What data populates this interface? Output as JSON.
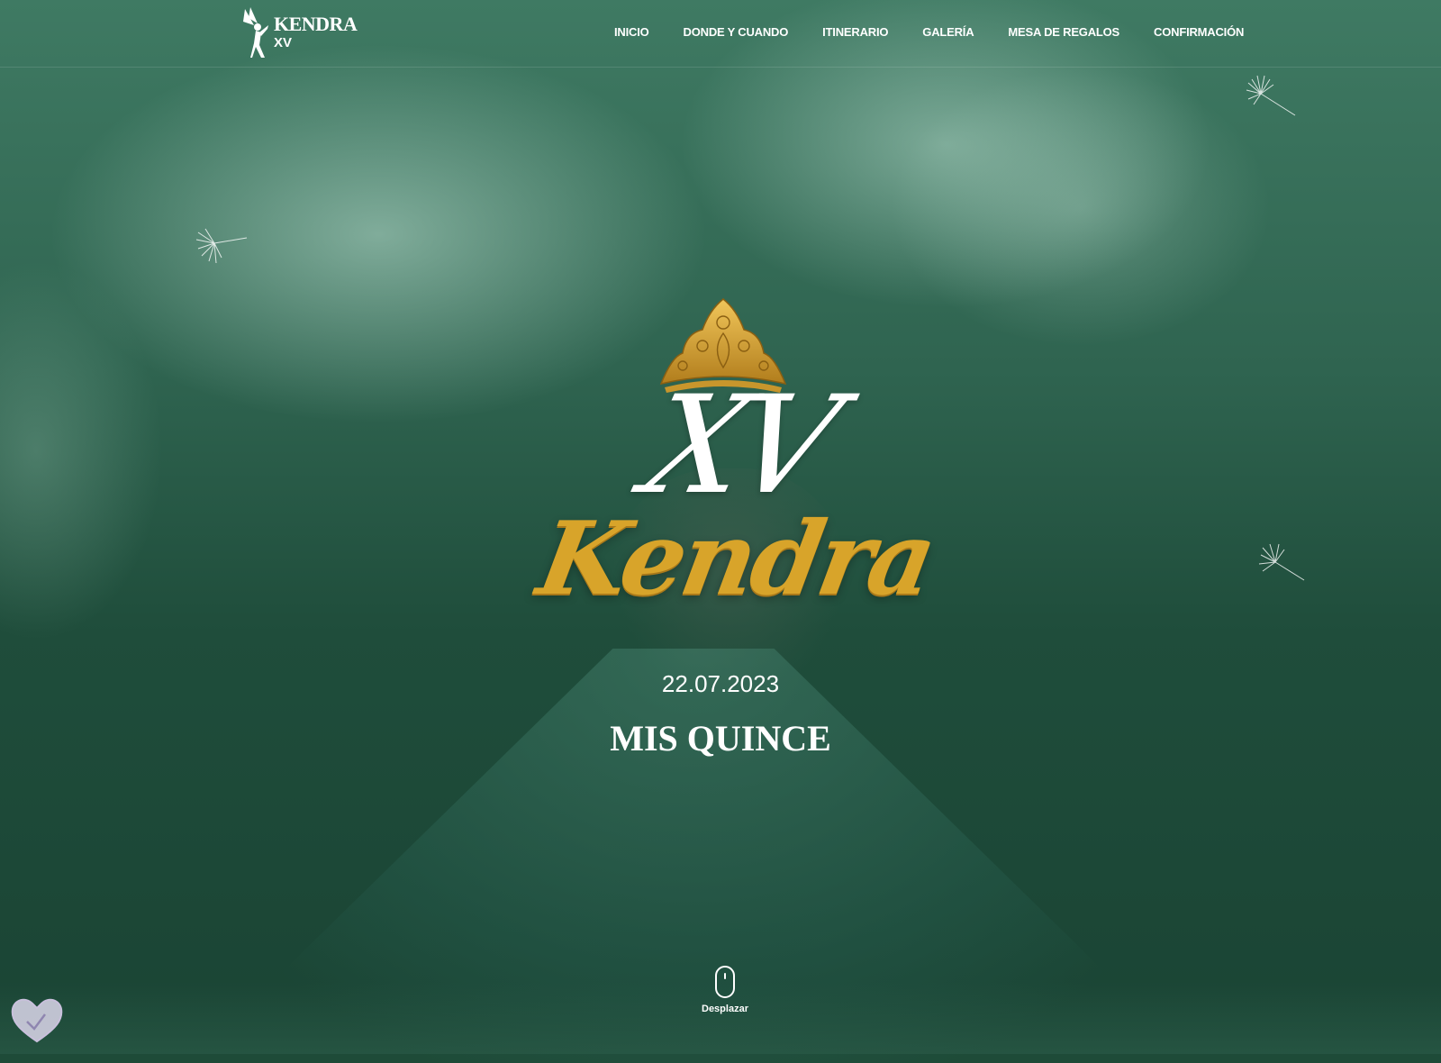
{
  "header": {
    "logo_title": "KENDRA",
    "logo_subtitle": "XV",
    "nav": [
      {
        "label": "INICIO"
      },
      {
        "label": "DONDE Y CUANDO"
      },
      {
        "label": "ITINERARIO"
      },
      {
        "label": "GALERÍA"
      },
      {
        "label": "MESA DE REGALOS"
      },
      {
        "label": "CONFIRMACIÓN"
      }
    ]
  },
  "hero": {
    "xv": "XV",
    "name": "Kendra",
    "date": "22.07.2023",
    "subtitle": "MIS QUINCE"
  },
  "scroll": {
    "label": "Desplazar"
  },
  "colors": {
    "overlay": "#2f6450",
    "gold": "#d8a42a",
    "text": "#ffffff"
  },
  "icons": [
    "fairy-logo-icon",
    "crown-icon",
    "mouse-scroll-icon",
    "dandelion-seed-icon",
    "heart-widget-icon"
  ]
}
